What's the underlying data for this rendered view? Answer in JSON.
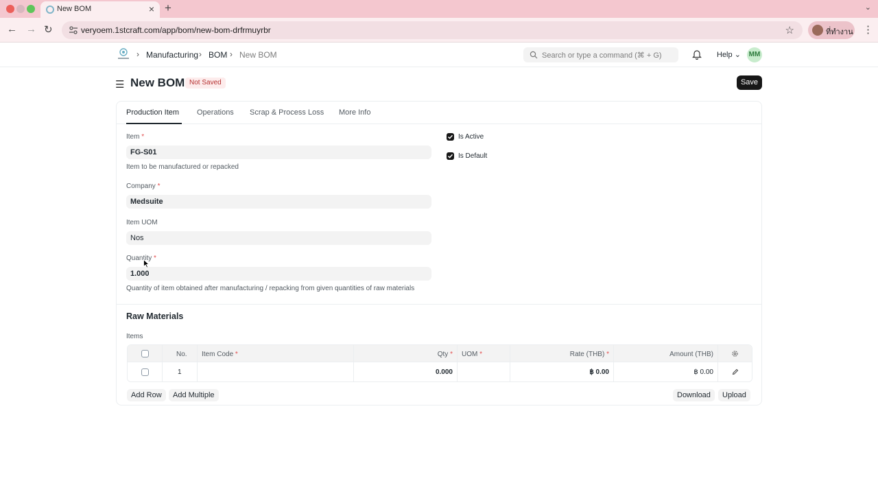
{
  "browser": {
    "tab_title": "New BOM",
    "url": "veryoem.1stcraft.com/app/bom/new-bom-drfrmuyrbr",
    "profile_label": "ที่ทำงาน"
  },
  "navbar": {
    "logo_icon": "veryoem-logo",
    "breadcrumbs": [
      "Manufacturing",
      "BOM",
      "New BOM"
    ],
    "search_placeholder": "Search or type a command (⌘ + G)",
    "help_label": "Help",
    "avatar_initials": "MM"
  },
  "page": {
    "title": "New BOM",
    "status": "Not Saved",
    "save_label": "Save"
  },
  "tabs": [
    "Production Item",
    "Operations",
    "Scrap & Process Loss",
    "More Info"
  ],
  "form": {
    "item": {
      "label": "Item",
      "value": "FG-S01",
      "help": "Item to be manufactured or repacked"
    },
    "company": {
      "label": "Company",
      "value": "Medsuite"
    },
    "item_uom": {
      "label": "Item UOM",
      "value": "Nos"
    },
    "quantity": {
      "label": "Quantity",
      "value": "1.000",
      "help": "Quantity of item obtained after manufacturing / repacking from given quantities of raw materials"
    },
    "is_active": {
      "label": "Is Active",
      "checked": true
    },
    "is_default": {
      "label": "Is Default",
      "checked": true
    }
  },
  "raw_materials": {
    "title": "Raw Materials",
    "items_label": "Items",
    "columns": [
      "No.",
      "Item Code",
      "Qty",
      "UOM",
      "Rate (THB)",
      "Amount (THB)"
    ],
    "rows": [
      {
        "no": "1",
        "item_code": "",
        "qty": "0.000",
        "uom": "",
        "rate": "฿ 0.00",
        "amount": "฿ 0.00"
      }
    ],
    "buttons": {
      "add_row": "Add Row",
      "add_multiple": "Add Multiple",
      "download": "Download",
      "upload": "Upload"
    }
  }
}
